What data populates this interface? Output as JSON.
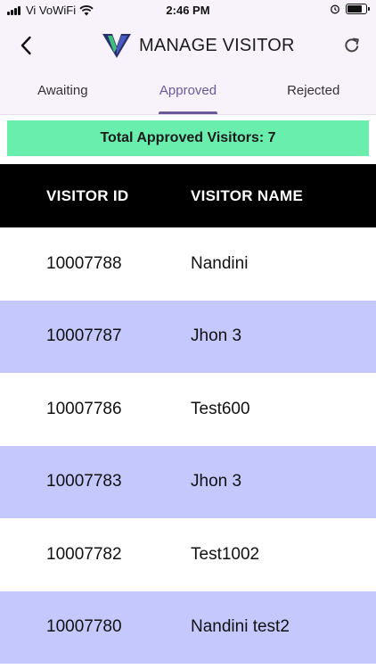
{
  "status_bar": {
    "carrier": "Vi VoWiFi",
    "time": "2:46 PM"
  },
  "header": {
    "title": "MANAGE VISITOR",
    "logo_color_dark": "#2b2f6b",
    "logo_color_accent": "#3fbf7f"
  },
  "tabs": [
    {
      "label": "Awaiting",
      "active": false
    },
    {
      "label": "Approved",
      "active": true
    },
    {
      "label": "Rejected",
      "active": false
    }
  ],
  "summary": {
    "text": "Total Approved Visitors: 7",
    "color": "#69eead"
  },
  "table": {
    "columns": [
      "VISITOR ID",
      "VISITOR NAME"
    ],
    "rows": [
      {
        "id": "10007788",
        "name": "Nandini"
      },
      {
        "id": "10007787",
        "name": "Jhon 3"
      },
      {
        "id": "10007786",
        "name": "Test600"
      },
      {
        "id": "10007783",
        "name": "Jhon 3"
      },
      {
        "id": "10007782",
        "name": "Test1002"
      },
      {
        "id": "10007780",
        "name": "Nandini test2"
      }
    ],
    "alt_row_color": "#c4c8fc"
  }
}
